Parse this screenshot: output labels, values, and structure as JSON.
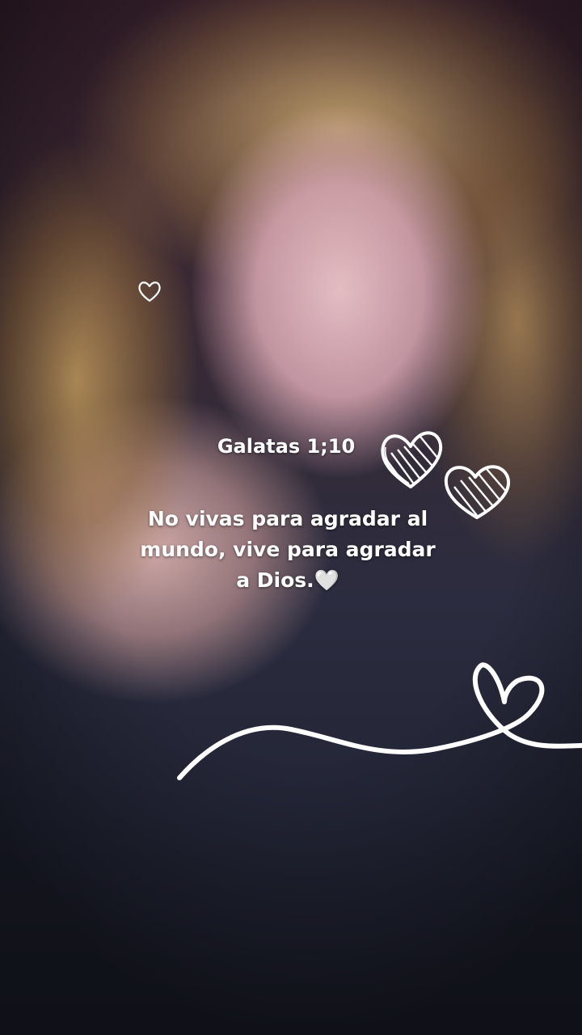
{
  "story": {
    "reference": "Galatas 1;10",
    "quote_lines": [
      "No vivas para agradar al",
      "mundo, vive para agradar",
      "a Dios.🤍"
    ]
  },
  "decorations": {
    "icons": [
      "heart-outline-icon",
      "heart-sketch-icon",
      "heart-sketch-icon",
      "heart-swirl-line-icon"
    ],
    "color": "#ffffff"
  }
}
